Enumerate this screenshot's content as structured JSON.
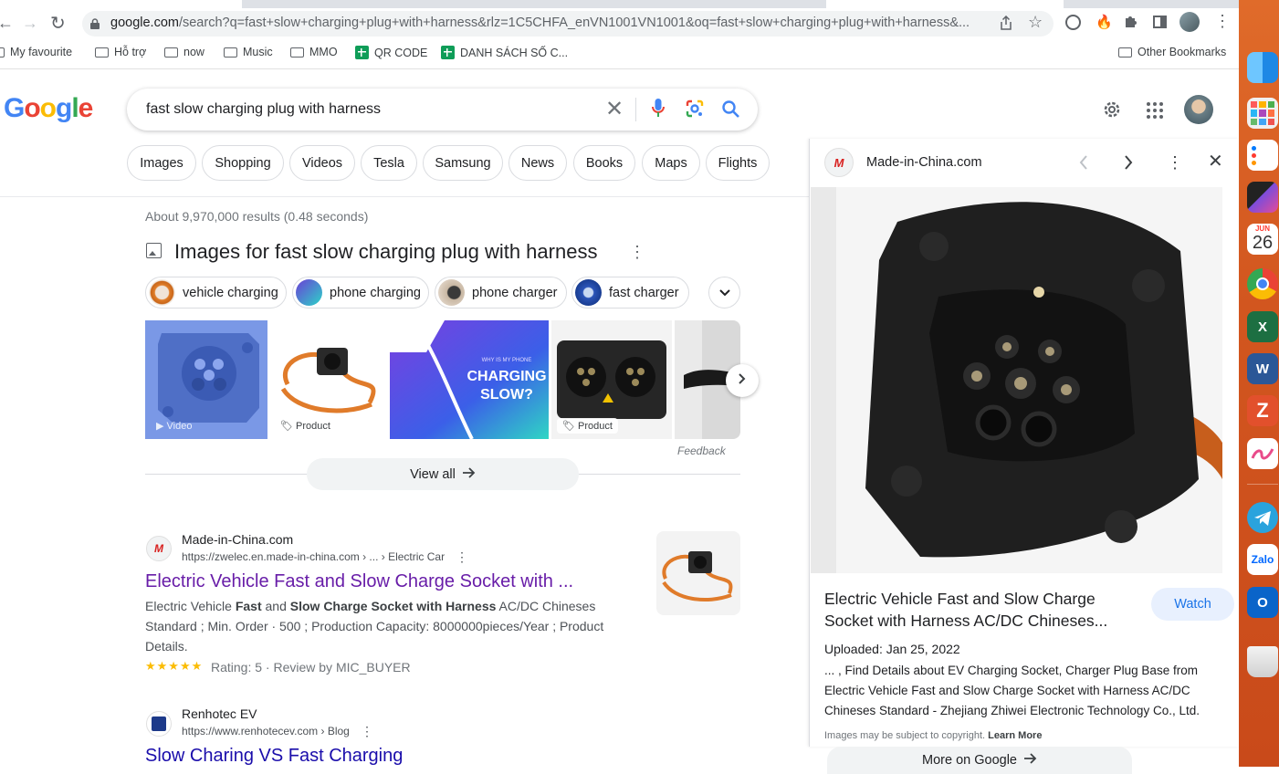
{
  "browser": {
    "url_host": "google.com",
    "url_rest": "/search?q=fast+slow+charging+plug+with+harness&rlz=1C5CHFA_enVN1001VN1001&oq=fast+slow+charging+plug+with+harness&...",
    "bookmarks": [
      "My favourite",
      "Hỗ trợ",
      "now",
      "Music",
      "MMO",
      "QR CODE",
      "DANH SÁCH SỐ C...",
      "Other Bookmarks"
    ]
  },
  "search": {
    "logo": [
      "G",
      "o",
      "o",
      "g",
      "l",
      "e"
    ],
    "query": "fast slow charging plug with harness",
    "chips": [
      "Images",
      "Shopping",
      "Videos",
      "Tesla",
      "Samsung",
      "News",
      "Books",
      "Maps",
      "Flights"
    ]
  },
  "results": {
    "stats": "About 9,970,000 results (0.48 seconds)",
    "images_title": "Images for fast slow charging plug with harness",
    "image_chips": [
      "vehicle charging",
      "phone charging",
      "phone charger",
      "fast charger"
    ],
    "tiles": [
      {
        "tag": "Video"
      },
      {
        "tag": "Product"
      },
      {
        "tag": ""
      },
      {
        "tag": "Product"
      },
      {
        "tag": ""
      }
    ],
    "charging_text": [
      "WHY IS MY PHONE",
      "CHARGING",
      "SLOW?"
    ],
    "feedback": "Feedback",
    "view_all": "View all",
    "r1": {
      "site": "Made-in-China.com",
      "cite": "https://zwelec.en.made-in-china.com › ... › Electric Car",
      "title": "Electric Vehicle Fast and Slow Charge Socket with ...",
      "snippet_a": "Electric Vehicle ",
      "snippet_b": "Fast",
      "snippet_c": " and ",
      "snippet_d": "Slow Charge Socket with Harness",
      "snippet_e": " AC/DC Chineses Standard ; Min. Order · 500 ; Production Capacity: 8000000pieces/Year ; Product Details.",
      "stars": "★★★★★",
      "rating": "Rating: 5 · Review by MIC_BUYER"
    },
    "r2": {
      "site": "Renhotec EV",
      "cite": "https://www.renhotecev.com › Blog",
      "title": "Slow Charing VS Fast Charging"
    }
  },
  "panel": {
    "source": "Made-in-China.com",
    "title": "Electric Vehicle Fast and Slow Charge Socket with Harness AC/DC Chineses...",
    "watch": "Watch",
    "uploaded": "Uploaded: Jan 25, 2022",
    "desc": "... , Find Details about EV Charging Socket, Charger Plug Base from Electric Vehicle Fast and Slow Charge Socket with Harness AC/DC Chineses Standard - Zhejiang Zhiwei Electronic Technology Co., Ltd.",
    "copyright": "Images may be subject to copyright.",
    "learn_more": "Learn More",
    "more_on_google": "More on Google"
  },
  "dock": {
    "calendar_month": "JUN",
    "calendar_day": "26"
  },
  "colors": {
    "link": "#681da8",
    "blue": "#1a73e8",
    "dock": "#d2561f"
  }
}
